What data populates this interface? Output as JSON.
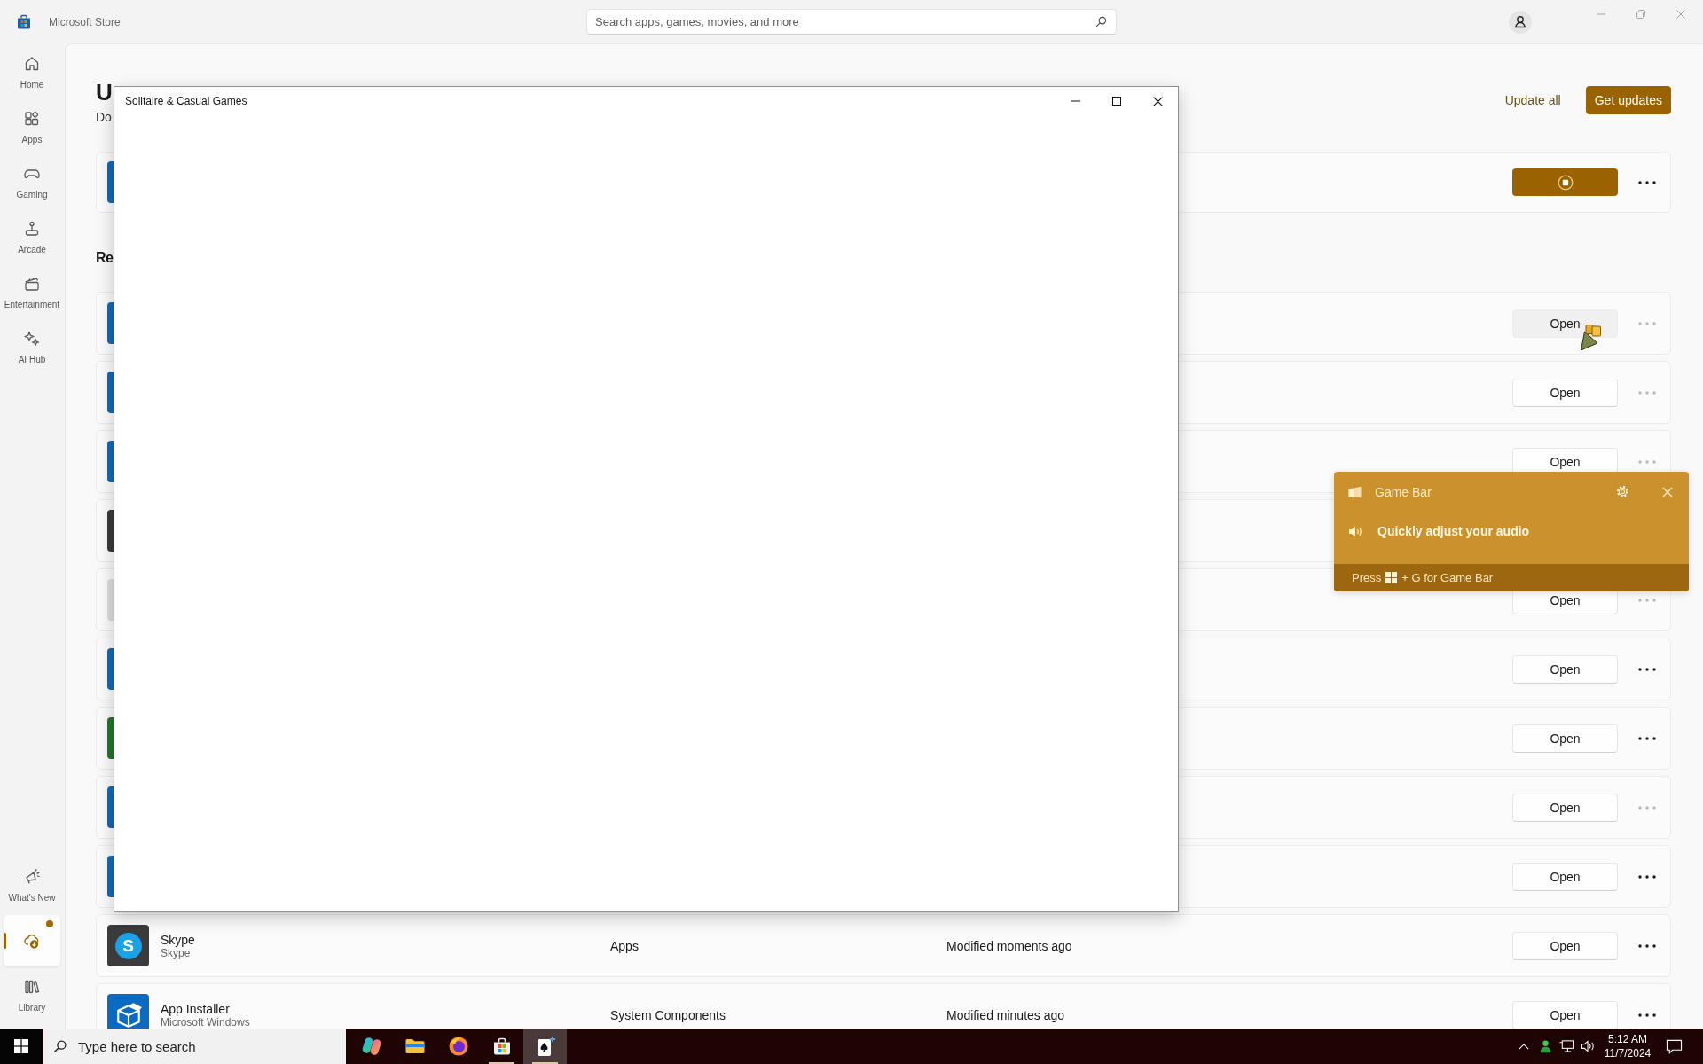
{
  "titlebar": {
    "app_name": "Microsoft Store",
    "search": {
      "placeholder": "Search apps, games, movies, and more"
    }
  },
  "sidebar": {
    "top_items": [
      {
        "label": "Home",
        "selected": false
      },
      {
        "label": "Apps",
        "selected": false
      },
      {
        "label": "Gaming",
        "selected": false
      },
      {
        "label": "Arcade",
        "selected": false
      },
      {
        "label": "Entertainment",
        "selected": false
      },
      {
        "label": "AI Hub",
        "selected": false
      }
    ],
    "bottom_items": [
      {
        "label": "What's New",
        "selected": false,
        "badge": false
      },
      {
        "selected": true,
        "badge": true
      },
      {
        "label": "Library",
        "selected": false,
        "badge": false
      }
    ]
  },
  "updates": {
    "heading": "U",
    "subtitle": "Do",
    "update_all": "Update all",
    "get_updates": "Get updates",
    "rows": [
      {
        "kind": "plain",
        "color": "#0b6bc2",
        "button": {
          "kind": "stop"
        },
        "more_disabled": false
      }
    ]
  },
  "recent": {
    "heading": "Re",
    "rows": [
      {
        "kind": "plain",
        "color": "#0b6bc2",
        "button": {
          "kind": "label",
          "label": "Open",
          "hovered": true
        },
        "more_disabled": true
      },
      {
        "kind": "plain",
        "color": "#0b6bc2",
        "button": {
          "kind": "label",
          "label": "Open",
          "hovered": false
        },
        "more_disabled": true
      },
      {
        "kind": "plain",
        "color": "#0b6bc2",
        "button": {
          "kind": "label",
          "label": "Open",
          "hovered": false
        },
        "more_disabled": true
      },
      {
        "kind": "plain",
        "color": "#3a3a3a"
      },
      {
        "kind": "plain",
        "color": "#dedede",
        "button": {
          "kind": "label",
          "label": "Open",
          "hovered": false
        },
        "more_disabled": true
      },
      {
        "kind": "plain",
        "color": "#0b6bc2",
        "button": {
          "kind": "label",
          "label": "Open",
          "hovered": false
        },
        "more_disabled": false
      },
      {
        "kind": "plain",
        "color": "#1c7c24",
        "button": {
          "kind": "label",
          "label": "Open",
          "hovered": false
        },
        "more_disabled": false
      },
      {
        "kind": "plain",
        "color": "#0b6bc2",
        "button": {
          "kind": "label",
          "label": "Open",
          "hovered": false
        },
        "more_disabled": true
      },
      {
        "kind": "plain",
        "color": "#0b6bc2",
        "button": {
          "kind": "label",
          "label": "Open",
          "hovered": false
        },
        "more_disabled": false
      },
      {
        "kind": "letter",
        "color": "#3b3b3b",
        "letter": "S",
        "name": "Skype",
        "publisher": "Skype",
        "category": "Apps",
        "modified": "Modified moments ago",
        "button": {
          "kind": "label",
          "label": "Open",
          "hovered": false
        },
        "more_disabled": false
      },
      {
        "kind": "box",
        "color": "#0b6bc2",
        "name": "App Installer",
        "publisher": "Microsoft Windows",
        "category": "System Components",
        "modified": "Modified minutes ago",
        "button": {
          "kind": "label",
          "label": "Open",
          "hovered": false
        },
        "more_disabled": false
      }
    ]
  },
  "app_window": {
    "title": "Solitaire & Casual Games"
  },
  "game_bar": {
    "title": "Game Bar",
    "message": "Quickly adjust your audio",
    "hint_start": "Press",
    "hint_end": "+ G for Game Bar"
  },
  "taskbar": {
    "search": {
      "placeholder": "Type here to search"
    },
    "apps": [
      {
        "running": false,
        "selected": false
      },
      {
        "running": false,
        "selected": false
      },
      {
        "running": false,
        "selected": false
      },
      {
        "running": true,
        "selected": false
      },
      {
        "running": true,
        "selected": true
      }
    ],
    "time": "5:12 AM",
    "date": "11/7/2024"
  }
}
